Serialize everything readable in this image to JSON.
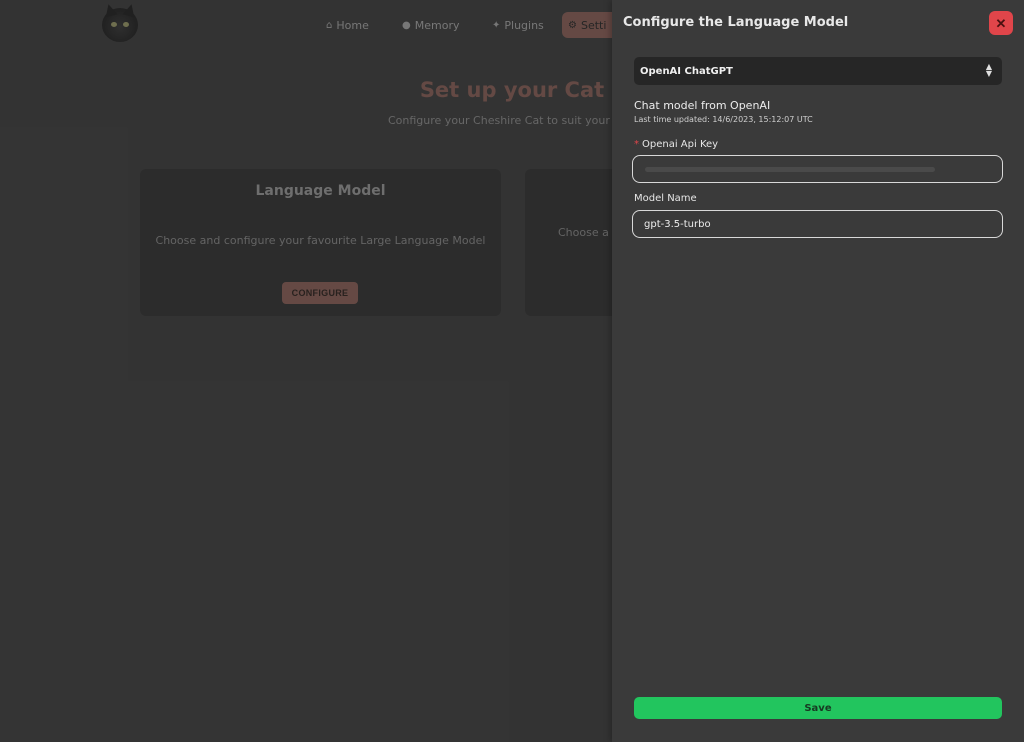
{
  "nav": {
    "home": "Home",
    "memory": "Memory",
    "plugins": "Plugins",
    "settings": "Setti",
    "icons": {
      "home": "house-icon",
      "memory": "brain-icon",
      "plugins": "puzzle-icon",
      "settings": "gear-icon"
    }
  },
  "hero": {
    "title": "Set up your Cat",
    "subtitle": "Configure your Cheshire Cat to suit your n"
  },
  "cards": [
    {
      "title": "Language Model",
      "description": "Choose and configure your favourite Large Language Model",
      "button": "CONFIGURE"
    },
    {
      "description": "Choose a l"
    }
  ],
  "drawer": {
    "title": "Configure the Language Model",
    "close_icon": "close-icon",
    "provider_select": {
      "value": "OpenAI ChatGPT"
    },
    "model_description": "Chat model from OpenAI",
    "last_updated": "Last time updated: 14/6/2023, 15:12:07 UTC",
    "fields": {
      "api_key_label": "Openai Api Key",
      "api_key_required_mark": "*",
      "model_name_label": "Model Name",
      "model_name_value": "gpt-3.5-turbo"
    },
    "save_label": "Save"
  },
  "colors": {
    "accent": "#8c625a",
    "save": "#22c55e",
    "close": "#e0454a",
    "background": "#3a3a3a"
  }
}
